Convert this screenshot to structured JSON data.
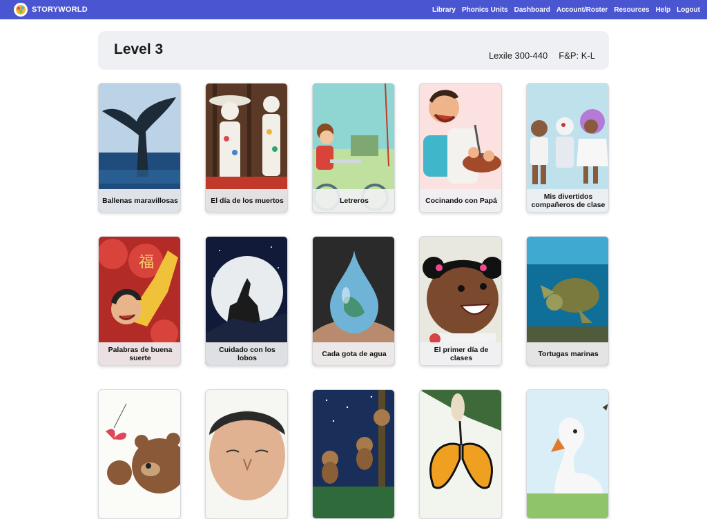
{
  "brand": {
    "name": "STORYWORLD"
  },
  "nav": {
    "items": [
      {
        "label": "Library"
      },
      {
        "label": "Phonics Units"
      },
      {
        "label": "Dashboard"
      },
      {
        "label": "Account/Roster"
      },
      {
        "label": "Resources"
      },
      {
        "label": "Help"
      },
      {
        "label": "Logout"
      }
    ]
  },
  "level": {
    "title": "Level 3",
    "lexile": "Lexile 300-440",
    "fp": "F&P: K-L"
  },
  "books": [
    {
      "title": "Ballenas maravillosas",
      "icon": "whale-tail-image"
    },
    {
      "title": "El día de los muertos",
      "icon": "skeleton-figures-image"
    },
    {
      "title": "Letreros",
      "icon": "boy-on-bike-image"
    },
    {
      "title": "Cocinando con Papá",
      "icon": "dad-cooking-image"
    },
    {
      "title": "Mis divertidos compañeros de clase",
      "icon": "classmates-image"
    },
    {
      "title": "Palabras de buena suerte",
      "icon": "lanterns-boy-image"
    },
    {
      "title": "Cuidado con los lobos",
      "icon": "wolf-moon-image"
    },
    {
      "title": "Cada gota de agua",
      "icon": "water-drop-image"
    },
    {
      "title": "El primer día de clases",
      "icon": "girl-smiling-image"
    },
    {
      "title": "Tortugas marinas",
      "icon": "sea-turtle-image"
    },
    {
      "title": "",
      "icon": "bear-butterfly-image"
    },
    {
      "title": "",
      "icon": "man-face-image"
    },
    {
      "title": "",
      "icon": "monkeys-night-image"
    },
    {
      "title": "",
      "icon": "monarch-butterfly-image"
    },
    {
      "title": "",
      "icon": "swan-image"
    }
  ]
}
